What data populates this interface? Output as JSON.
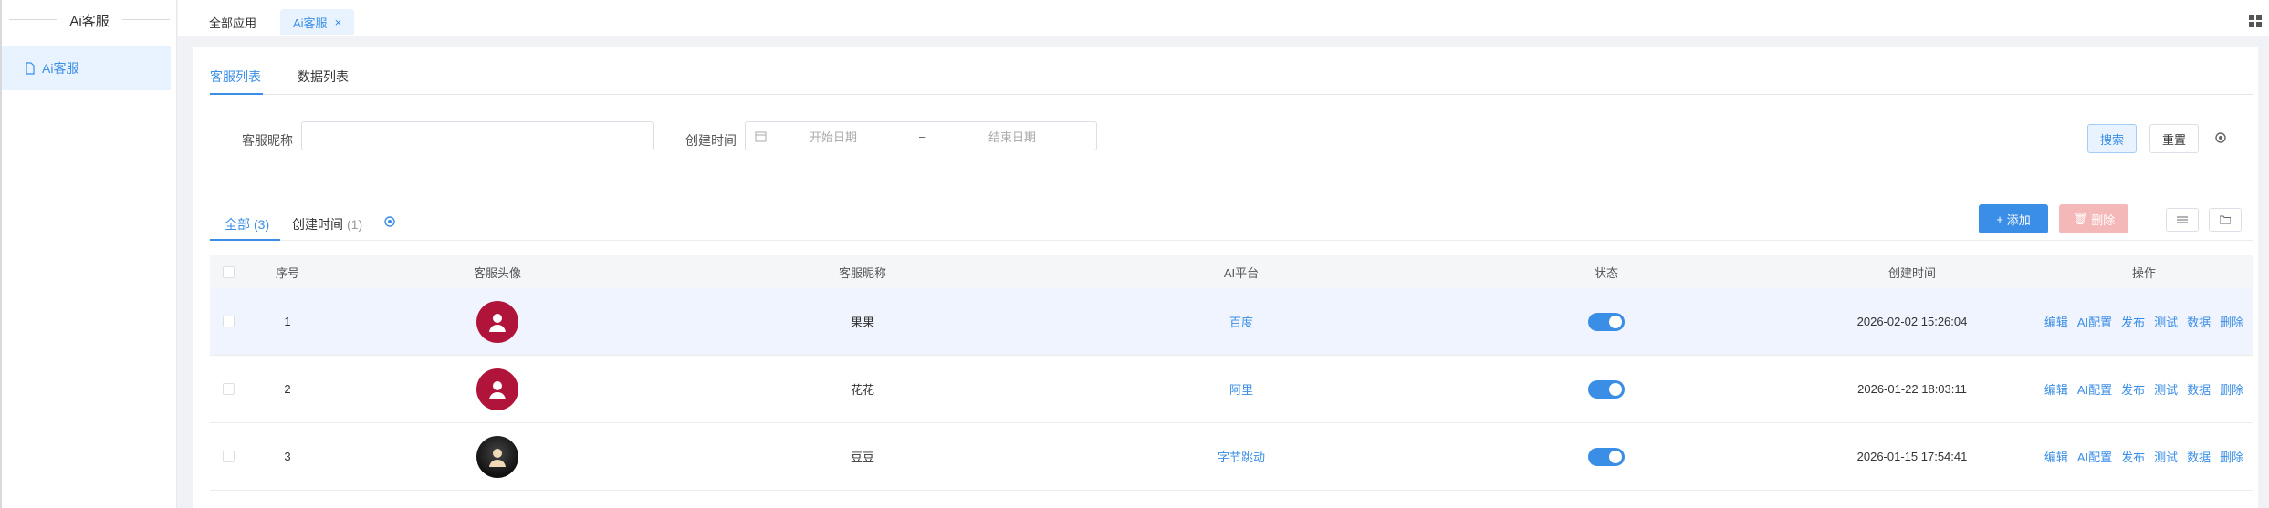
{
  "sidebar": {
    "title": "Ai客服",
    "items": [
      {
        "label": "Ai客服"
      }
    ]
  },
  "topbar": {
    "tabs": [
      {
        "label": "全部应用"
      },
      {
        "label": "Ai客服"
      }
    ],
    "close_glyph": "×"
  },
  "subtabs": [
    {
      "label": "客服列表"
    },
    {
      "label": "数据列表"
    }
  ],
  "filters": {
    "nickname_label": "客服昵称",
    "nickname_value": "",
    "created_label": "创建时间",
    "start_placeholder": "开始日期",
    "range_sep": "–",
    "end_placeholder": "结束日期",
    "search_label": "搜索",
    "reset_label": "重置"
  },
  "filter_tabs": [
    {
      "label": "全部",
      "count": "(3)"
    },
    {
      "label": "创建时间",
      "count": "(1)"
    }
  ],
  "actions": {
    "add_label": "添加",
    "delete_label": "删除"
  },
  "table": {
    "headers": [
      "序号",
      "客服头像",
      "客服昵称",
      "AI平台",
      "状态",
      "创建时间",
      "操作"
    ],
    "rows": [
      {
        "no": "1",
        "nickname": "果果",
        "platform": "百度",
        "status": true,
        "created": "2026-02-02 15:26:04"
      },
      {
        "no": "2",
        "nickname": "花花",
        "platform": "阿里",
        "status": true,
        "created": "2026-01-22 18:03:11"
      },
      {
        "no": "3",
        "nickname": "豆豆",
        "platform": "字节跳动",
        "status": true,
        "created": "2026-01-15 17:54:41"
      }
    ],
    "ops": [
      "编辑",
      "AI配置",
      "发布",
      "测试",
      "数据",
      "删除"
    ]
  },
  "colors": {
    "accent": "#3a8ee6",
    "danger_light": "#f5b8b8",
    "avatar_red": "#b0143a"
  }
}
